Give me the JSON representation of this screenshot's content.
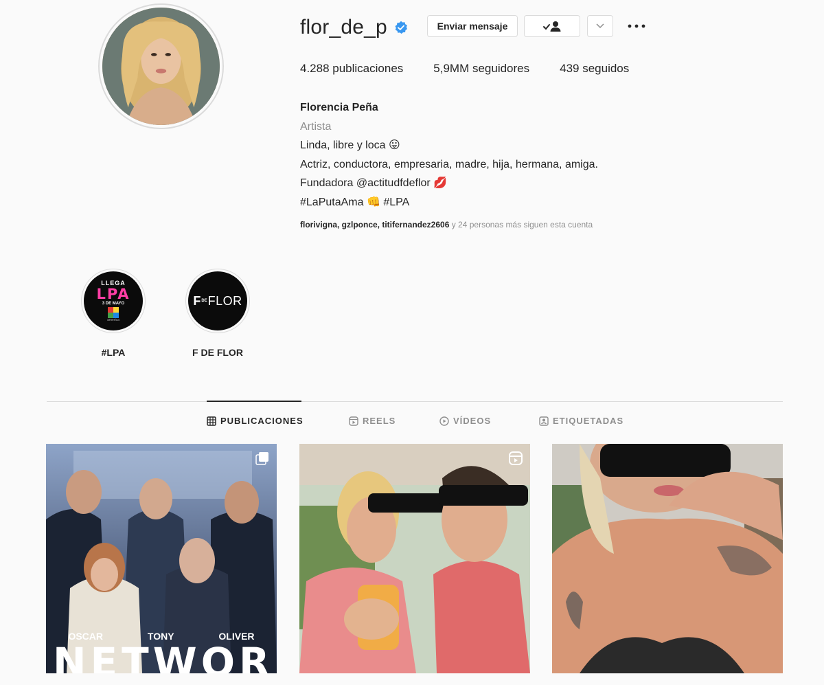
{
  "profile": {
    "username": "flor_de_p",
    "verified": true,
    "message_button": "Enviar mensaje",
    "stats": {
      "posts": "4.288 publicaciones",
      "followers": "5,9MM seguidores",
      "following": "439 seguidos"
    },
    "bio": {
      "name": "Florencia Peña",
      "category": "Artista",
      "line1": "Linda, libre y loca 😛",
      "line2": "Actriz, conductora, empresaria, madre, hija, hermana, amiga.",
      "line3": "Fundadora @actitudfdeflor 💋",
      "line4": "#LaPutaAma 👊 #LPA"
    },
    "followed_by": {
      "names": "florivigna, gzlponce, titifernandez2606",
      "rest": " y 24 personas más siguen esta cuenta"
    }
  },
  "highlights": [
    {
      "label": "#LPA",
      "cover_top": "LLEGA",
      "cover_main": "LPA",
      "cover_sub": "3 DE MAYO",
      "cover_brand": "america"
    },
    {
      "label": "F DE FLOR",
      "cover_main": "FLOR",
      "cover_prefix": "F",
      "cover_small": "DE"
    }
  ],
  "tabs": [
    {
      "label": "PUBLICACIONES",
      "icon": "grid-icon",
      "active": true
    },
    {
      "label": "REELS",
      "icon": "reels-icon",
      "active": false
    },
    {
      "label": "VÍDEOS",
      "icon": "play-icon",
      "active": false
    },
    {
      "label": "ETIQUETADAS",
      "icon": "tagged-icon",
      "active": false
    }
  ],
  "posts": [
    {
      "type": "carousel",
      "names": [
        "OSCAR",
        "TONY",
        "OLIVER"
      ],
      "title": "NETWORK"
    },
    {
      "type": "reel"
    },
    {
      "type": "image"
    }
  ],
  "colors": {
    "accent_blue": "#3897f0",
    "border": "#dbdbdb",
    "muted": "#8e8e8e",
    "text": "#262626"
  }
}
